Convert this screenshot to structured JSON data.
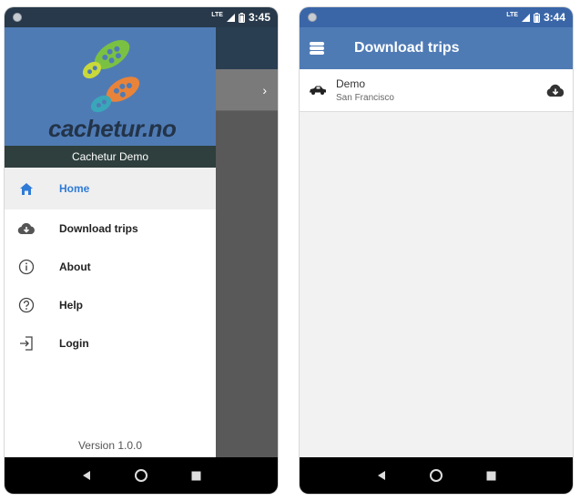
{
  "left_phone": {
    "status": {
      "network": "LTE",
      "time": "3:45"
    },
    "brand": "cachetur.no",
    "account_name": "Cachetur Demo",
    "menu": [
      {
        "label": "Home",
        "icon": "home-icon",
        "active": true
      },
      {
        "label": "Download trips",
        "icon": "cloud-download-icon",
        "active": false
      },
      {
        "label": "About",
        "icon": "info-icon",
        "active": false
      },
      {
        "label": "Help",
        "icon": "help-icon",
        "active": false
      },
      {
        "label": "Login",
        "icon": "login-icon",
        "active": false
      }
    ],
    "version": "Version 1.0.0",
    "background_row_arrow": "›"
  },
  "right_phone": {
    "status": {
      "network": "LTE",
      "time": "3:44"
    },
    "title": "Download trips",
    "trips": [
      {
        "name": "Demo",
        "location": "San Francisco",
        "icon": "car-icon",
        "action_icon": "cloud-download-icon"
      }
    ]
  },
  "colors": {
    "primary": "#4f7bb5",
    "accent": "#2f7bd6",
    "drawer_subheader": "#2e3f3d"
  }
}
